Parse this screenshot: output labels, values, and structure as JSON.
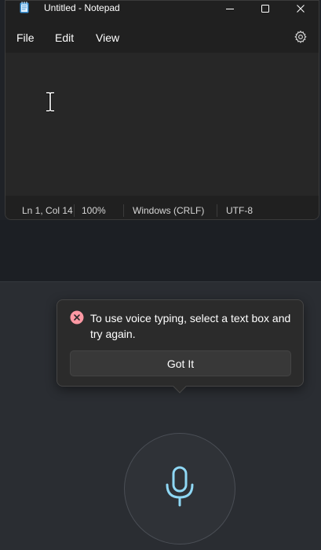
{
  "window": {
    "title": "Untitled - Notepad",
    "app_icon": "notepad-icon",
    "controls": [
      "minimize-icon",
      "maximize-icon",
      "close-icon"
    ]
  },
  "menu": {
    "items": [
      {
        "label": "File"
      },
      {
        "label": "Edit"
      },
      {
        "label": "View"
      }
    ],
    "settings_icon": "gear-icon"
  },
  "editor": {
    "cursor_icon": "ibeam-cursor-icon"
  },
  "statusbar": {
    "position": "Ln 1, Col 14",
    "zoom": "100%",
    "line_ending": "Windows (CRLF)",
    "encoding": "UTF-8"
  },
  "voice": {
    "message": "To use voice typing, select a text box and try again.",
    "button_label": "Got It",
    "error_icon": "error-circle-icon",
    "mic_icon": "microphone-icon",
    "colors": {
      "error": "#ff99a4",
      "mic": "#8fd8f5"
    }
  }
}
